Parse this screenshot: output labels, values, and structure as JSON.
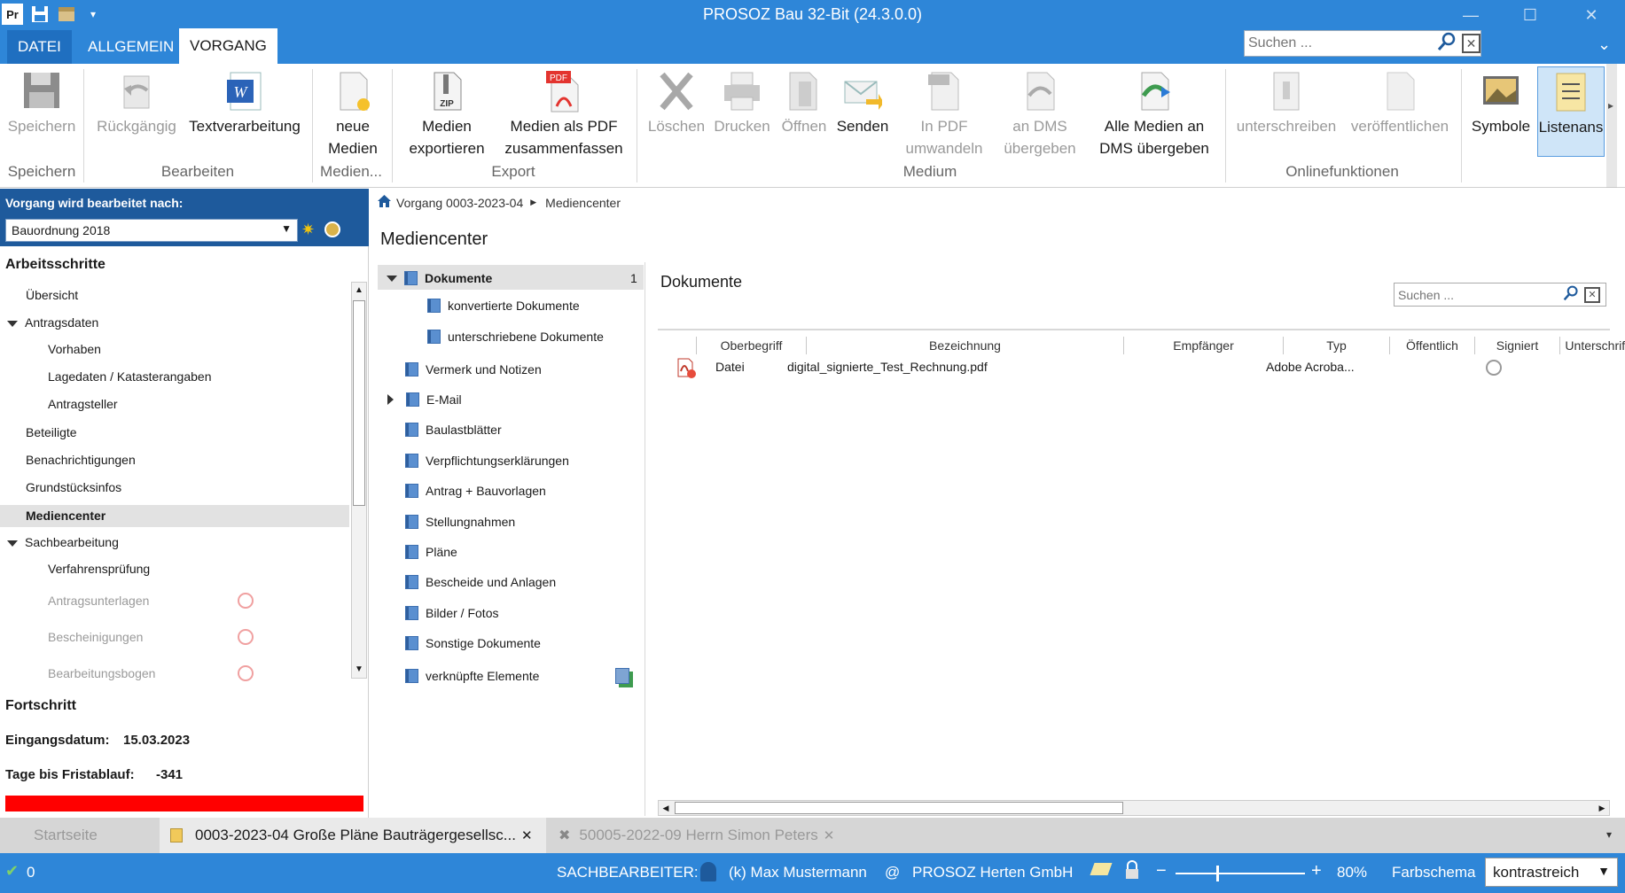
{
  "window": {
    "title": "PROSOZ Bau 32-Bit (24.3.0.0)",
    "app_icon": "Pr"
  },
  "ribbon_tabs": [
    "DATEI",
    "ALLGEMEIN",
    "VORGANG"
  ],
  "top_search": {
    "placeholder": "Suchen ..."
  },
  "ribbon": {
    "buttons": {
      "speichern": "Speichern",
      "rueckgaengig": "Rückgängig",
      "textverarbeitung": "Textverarbeitung",
      "neue_medien_1": "neue",
      "neue_medien_2": "Medien",
      "medien_exportieren_1": "Medien",
      "medien_exportieren_2": "exportieren",
      "pdf_zusammen_1": "Medien als PDF",
      "pdf_zusammen_2": "zusammenfassen",
      "loeschen": "Löschen",
      "drucken": "Drucken",
      "oeffnen": "Öffnen",
      "senden": "Senden",
      "in_pdf_1": "In PDF",
      "in_pdf_2": "umwandeln",
      "an_dms_1": "an DMS",
      "an_dms_2": "übergeben",
      "alle_dms_1": "Alle Medien an",
      "alle_dms_2": "DMS übergeben",
      "unterschreiben": "unterschreiben",
      "veroeffentlichen": "veröffentlichen",
      "symbole": "Symbole",
      "listenansicht": "Listenans"
    },
    "groups": {
      "speichern": "Speichern",
      "bearbeiten": "Bearbeiten",
      "medien": "Medien...",
      "export": "Export",
      "medium": "Medium",
      "online": "Onlinefunktionen"
    },
    "zip_label": "ZIP",
    "pdf_label": "PDF"
  },
  "left": {
    "header_label": "Vorgang wird bearbeitet nach:",
    "dropdown_value": "Bauordnung 2018",
    "section_title": "Arbeitsschritte",
    "items": {
      "uebersicht": "Übersicht",
      "antragsdaten": "Antragsdaten",
      "vorhaben": "Vorhaben",
      "lagedaten": "Lagedaten / Katasterangaben",
      "antragsteller": "Antragsteller",
      "beteiligte": "Beteiligte",
      "benachrichtigungen": "Benachrichtigungen",
      "grundstuecksinfos": "Grundstücksinfos",
      "mediencenter": "Mediencenter",
      "sachbearbeitung": "Sachbearbeitung",
      "verfahrenspruefung": "Verfahrensprüfung",
      "antragsunterlagen": "Antragsunterlagen",
      "bescheinigungen": "Bescheinigungen",
      "bearbeitungsbogen": "Bearbeitungsbogen"
    },
    "fortschritt_title": "Fortschritt",
    "eingangsdatum_label": "Eingangsdatum:",
    "eingangsdatum_value": "15.03.2023",
    "tage_label": "Tage bis Fristablauf:",
    "tage_value": "-341",
    "progress_color": "#ff0000"
  },
  "breadcrumb": {
    "item1": "Vorgang 0003-2023-04",
    "item2": "Mediencenter"
  },
  "page_title": "Mediencenter",
  "folders": {
    "dokumente": "Dokumente",
    "dokumente_count": "1",
    "konvertierte": "konvertierte Dokumente",
    "unterschriebene": "unterschriebene Dokumente",
    "vermerk": "Vermerk und Notizen",
    "email": "E-Mail",
    "baulast": "Baulastblätter",
    "verpflichtung": "Verpflichtungserklärungen",
    "antrag": "Antrag + Bauvorlagen",
    "stellung": "Stellungnahmen",
    "plaene": "Pläne",
    "bescheide": "Bescheide und Anlagen",
    "bilder": "Bilder / Fotos",
    "sonstige": "Sonstige Dokumente",
    "verknuepfte": "verknüpfte Elemente"
  },
  "documents": {
    "title": "Dokumente",
    "search_placeholder": "Suchen ...",
    "columns": [
      "Oberbegriff",
      "Bezeichnung",
      "Empfänger",
      "Typ",
      "Öffentlich",
      "Signiert",
      "Unterschriften"
    ],
    "rows": [
      {
        "oberbegriff": "Datei",
        "bezeichnung": "digital_signierte_Test_Rechnung.pdf",
        "empfaenger": "",
        "typ": "Adobe Acroba...",
        "oeffentlich": ""
      }
    ]
  },
  "doc_tabs": {
    "startseite": "Startseite",
    "tab1": "0003-2023-04 Große Pläne Bauträgergesellsc...",
    "tab2": "50005-2022-09 Herrn Simon Peters"
  },
  "status": {
    "count": "0",
    "sachbearbeiter_label": "SACHBEARBEITER:",
    "user": "(k) Max Mustermann",
    "at": "@",
    "org": "PROSOZ Herten GmbH",
    "zoom": "80%",
    "farbschema_label": "Farbschema",
    "farbschema_value": "kontrastreich"
  }
}
